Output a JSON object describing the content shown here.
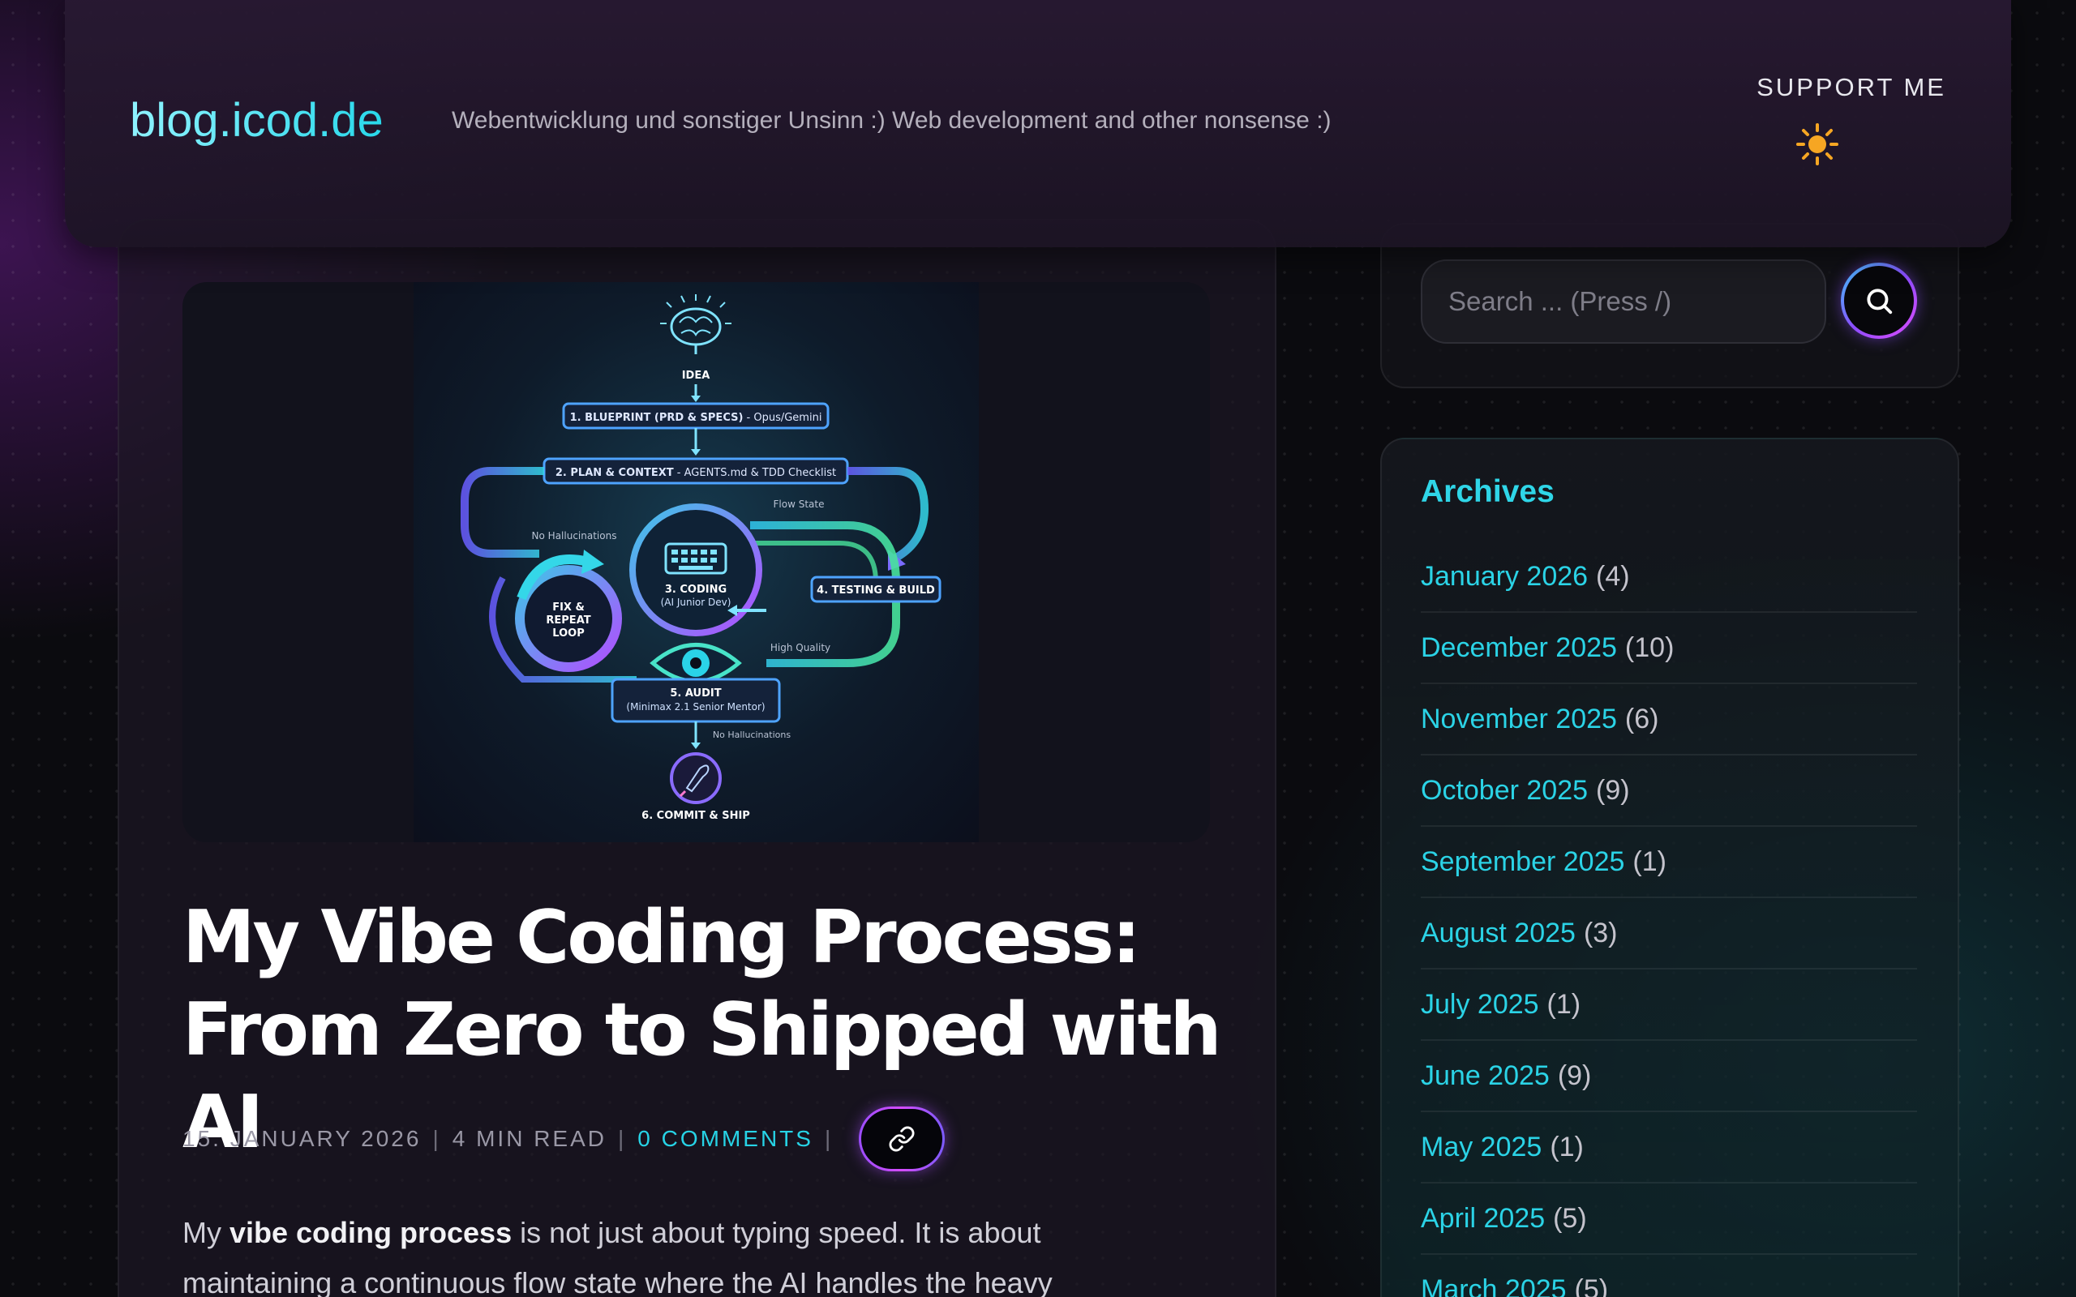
{
  "header": {
    "site_title": "blog.icod.de",
    "tagline": "Webentwicklung und sonstiger Unsinn :) Web development and other nonsense :)",
    "support_label": "SUPPORT ME",
    "theme_icon": "sun-icon"
  },
  "hero": {
    "diagram": {
      "idea": "IDEA",
      "step1_bold": "1. BLUEPRINT (PRD & SPECS)",
      "step1_rest": " - Opus/Gemini",
      "step2_bold": "2. PLAN & CONTEXT",
      "step2_rest": " - AGENTS.md & TDD Checklist",
      "flow_state": "Flow State",
      "no_hallucinations_top": "No Hallucinations",
      "step3_title": "3. CODING",
      "step3_sub": "(AI Junior Dev)",
      "loop_line1": "FIX &",
      "loop_line2": "REPEAT",
      "loop_line3": "LOOP",
      "step4": "4. TESTING & BUILD",
      "high_quality": "High Quality",
      "step5_title": "5. AUDIT",
      "step5_sub": "(Minimax 2.1 Senior Mentor)",
      "no_hallucinations_bottom": "No Hallucinations",
      "step6": "6. COMMIT & SHIP"
    }
  },
  "post": {
    "title_line1": "My Vibe Coding Process:",
    "title_line2": "From Zero to Shipped with AI",
    "date": "15. JANUARY 2026",
    "read_time": "4 MIN READ",
    "comments": "0 COMMENTS",
    "separator": "|",
    "permalink_icon": "link-icon",
    "lead_prefix": "My ",
    "lead_bold": "vibe coding process",
    "lead_rest": " is not just about typing speed. It is about maintaining a continuous flow state where the AI handles the heavy"
  },
  "sidebar": {
    "search_placeholder": "Search ... (Press /)",
    "search_icon": "search-icon",
    "archives_title": "Archives",
    "archives": [
      {
        "label": "January 2026",
        "count": "(4)"
      },
      {
        "label": "December 2025",
        "count": "(10)"
      },
      {
        "label": "November 2025",
        "count": "(6)"
      },
      {
        "label": "October 2025",
        "count": "(9)"
      },
      {
        "label": "September 2025",
        "count": "(1)"
      },
      {
        "label": "August 2025",
        "count": "(3)"
      },
      {
        "label": "July 2025",
        "count": "(1)"
      },
      {
        "label": "June 2025",
        "count": "(9)"
      },
      {
        "label": "May 2025",
        "count": "(1)"
      },
      {
        "label": "April 2025",
        "count": "(5)"
      },
      {
        "label": "March 2025",
        "count": "(5)"
      }
    ]
  },
  "colors": {
    "accent_cyan": "#27d3e6",
    "accent_purple": "#9b4dff",
    "sun_orange": "#f6a623"
  }
}
